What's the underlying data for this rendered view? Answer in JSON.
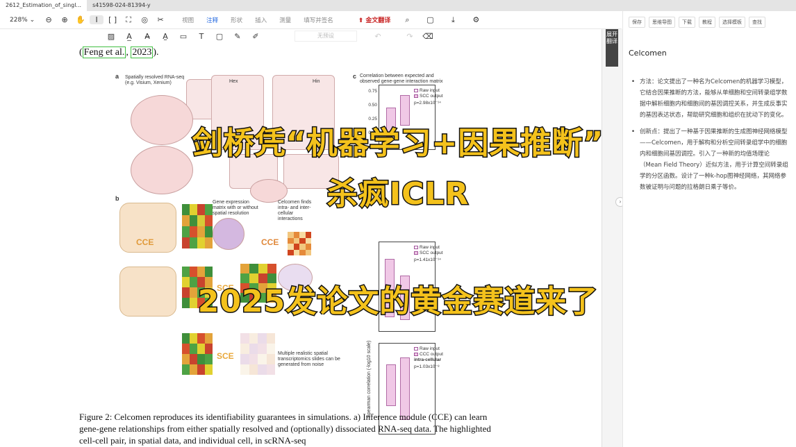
{
  "tabs": [
    {
      "label": "2612_Estimation_of_singl..."
    },
    {
      "label": "s41598-024-81394-y"
    }
  ],
  "toolbar": {
    "zoom": "228%",
    "menus": [
      "视图",
      "注释",
      "形状",
      "插入",
      "测量",
      "填写并签名"
    ],
    "active_menu": "注释",
    "translate": "金文翻译"
  },
  "subbar": {
    "preset": "无预设"
  },
  "doc": {
    "cite_text_1": "Feng et al.",
    "cite_text_2": "2023",
    "caption": "Figure 2: Celcomen reproduces its identifiability guarantees in simulations. a) Inference module (CCE) can learn gene-gene relationships from either spatially resolved and (optionally) dissociated RNA-seq data. The highlighted cell-cell pair, in spatial data, and individual cell, in scRNA-seq",
    "figure": {
      "panel_a": "a",
      "panel_b": "b",
      "panel_c": "c",
      "spatial_label": "Spatially resolved RNA-seq",
      "spatial_sub": "(e.g. Visium, Xenium)",
      "h_ex": "Hex",
      "h_in": "Hin",
      "gene_matrix": "Gene expression matrix with or without spatial resolution",
      "celcomen_finds": "Celcomen finds intra- and inter-cellular interactions",
      "cce": "CCE",
      "sce": "SCE",
      "multiple": "Multiple realistic spatial transcriptomics slides can be generated from noise",
      "corr_title_1": "Correlation between expected and",
      "corr_title_2": "observed gene-gene interaction matrix",
      "ylabel": "Spearman correlation (-log10 scale)",
      "legend_raw": "Raw input",
      "legend_scc": "SCC output",
      "legend_ccc": "CCC output",
      "intra": "intra-cellular",
      "p1": "p=2.98x10⁻¹⁴",
      "p2": "p=1.41x10⁻¹⁴",
      "p3": "p=1.03x10⁻⁸",
      "ticks_top": [
        "0.75",
        "0.50",
        "0.25",
        "0.00"
      ]
    }
  },
  "side_tab": "展开翻译",
  "rpanel": {
    "buttons": [
      "保存",
      "思维导图",
      "下载",
      "教程",
      "选择模板",
      "查找"
    ],
    "title": "Celcomen",
    "bullets": [
      "方法：论文提出了一种名为Celcomen的机器学习模型，它结合因果推断的方法，能够从单细胞和空间转录组学数据中解析细胞内和细胞间的基因调控关系，并生成反事实的基因表达状态，帮助研究细胞和组织在扰动下的变化。",
      "创新点：提出了一种基于因果推断的生成图神经网络模型——Celcomen，用于解构和分析空间转录组学中的细胞内和细胞间基因调控。引入了一种新的均值场理论（Mean Field Theory）近似方法，用于计算空间转录组学的分区函数。设计了一种k-hop图神经网络，其网络参数被证明与问题的拉格朗日乘子等价。"
    ]
  },
  "overlay": {
    "line1": "剑桥凭“机器学习+因果推断”",
    "line2": "杀疯ICLR",
    "line3": "2025发论文的黄金赛道来了"
  }
}
